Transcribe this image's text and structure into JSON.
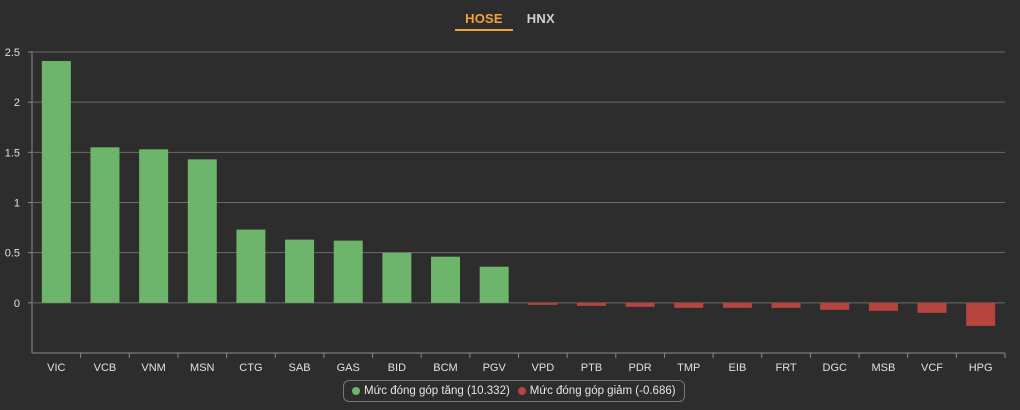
{
  "tabs": [
    {
      "label": "HOSE",
      "active": true
    },
    {
      "label": "HNX",
      "active": false
    }
  ],
  "legend": {
    "positive_label": "Mức đóng góp tăng (10.332)",
    "negative_label": "Mức đóng góp giảm (-0.686)"
  },
  "colors": {
    "positive": "#6db56a",
    "negative": "#b8443f",
    "accent": "#f0a23b",
    "background": "#2d2d2d",
    "grid": "#6a6a6a",
    "text": "#e0e0e0"
  },
  "chart_data": {
    "type": "bar",
    "categories": [
      "VIC",
      "VCB",
      "VNM",
      "MSN",
      "CTG",
      "SAB",
      "GAS",
      "BID",
      "BCM",
      "PGV",
      "VPD",
      "PTB",
      "PDR",
      "TMP",
      "EIB",
      "FRT",
      "DGC",
      "MSB",
      "VCF",
      "HPG"
    ],
    "values": [
      2.41,
      1.55,
      1.53,
      1.43,
      0.73,
      0.63,
      0.62,
      0.5,
      0.46,
      0.36,
      -0.02,
      -0.03,
      -0.04,
      -0.05,
      -0.05,
      -0.05,
      -0.07,
      -0.08,
      -0.1,
      -0.23
    ],
    "ylim": [
      -0.5,
      2.5
    ],
    "yticks": [
      "2.5",
      "2",
      "1.5",
      "1",
      "0.5",
      "0"
    ],
    "ytick_values": [
      2.5,
      2,
      1.5,
      1,
      0.5,
      0
    ],
    "grid": true,
    "legend_position": "bottom-center"
  }
}
